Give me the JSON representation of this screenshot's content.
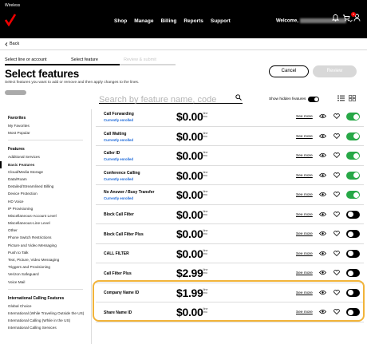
{
  "header": {
    "wireless_label": "Wireless",
    "nav": [
      "Shop",
      "Manage",
      "Billing",
      "Reports",
      "Support"
    ],
    "welcome": "Welcome,",
    "notification_count": "1"
  },
  "back_label": "Back",
  "steps": [
    "Select line or account",
    "Select feature",
    "Review & submit"
  ],
  "page": {
    "title": "Select features",
    "subtitle": "Select features you want to add or remove and then apply changes to the lines.",
    "cancel_label": "Cancel",
    "review_label": "Review"
  },
  "search": {
    "placeholder": "Search by feature name, code",
    "show_hidden_label": "Show hidden features"
  },
  "sidebar": {
    "groups": [
      {
        "title": "Favorites",
        "items": [
          "My Favorites",
          "Most Popular"
        ]
      },
      {
        "title": "Features",
        "items": [
          "Additional Services",
          "Basic Features",
          "Cloud/Media Storage",
          "Data/Roam",
          "Detailed/Streamlined Billing",
          "Device Protection",
          "HD Voice",
          "IP Provisioning",
          "Miscellaneous-Account Level",
          "Miscellaneous-Line Level",
          "Other",
          "Phone Switch Restrictions",
          "Picture and Video Messaging",
          "Push to Talk",
          "Text, Picture, Video Messaging",
          "Triggers and Provisioning",
          "Verizon Safeguard",
          "Voice Mail"
        ]
      },
      {
        "title": "International Calling Features",
        "items": [
          "Global Choice",
          "International (While Traveling Outside the US)",
          "International Calling (While in the US)",
          "International Calling Services"
        ]
      }
    ],
    "active_item": "Basic Features"
  },
  "features": [
    {
      "name": "Call Forwarding",
      "status": "Currently enrolled",
      "price": "$0.00",
      "per": [
        "/line",
        "/mo"
      ],
      "see_more": "See more",
      "enabled": true
    },
    {
      "name": "Call Waiting",
      "status": "Currently enrolled",
      "price": "$0.00",
      "per": [
        "/line",
        "/mo"
      ],
      "see_more": "See more",
      "enabled": true
    },
    {
      "name": "Caller ID",
      "status": "Currently enrolled",
      "price": "$0.00",
      "per": [
        "/line",
        "/mo"
      ],
      "see_more": "See more",
      "enabled": true
    },
    {
      "name": "Conference Calling",
      "status": "Currently enrolled",
      "price": "$0.00",
      "per": [
        "/line",
        "/mo"
      ],
      "see_more": "See more",
      "enabled": true
    },
    {
      "name": "No Answer / Busy Transfer",
      "status": "Currently enrolled",
      "price": "$0.00",
      "per": [
        "/line",
        "/mo"
      ],
      "see_more": "See more",
      "enabled": true
    },
    {
      "name": "Block Call Filter",
      "status": "",
      "price": "$0.00",
      "per": [
        "/line",
        "/mo"
      ],
      "see_more": "See more",
      "enabled": false
    },
    {
      "name": "Block Call Filter Plus",
      "status": "",
      "price": "$0.00",
      "per": [
        "/line",
        "/mo"
      ],
      "see_more": "See more",
      "enabled": false
    },
    {
      "name": "CALL FILTER",
      "status": "",
      "price": "$0.00",
      "per": [
        "/line",
        "/mo"
      ],
      "see_more": "See more",
      "enabled": false
    },
    {
      "name": "Call Filter Plus",
      "status": "",
      "price": "$2.99",
      "per": [
        "/line",
        "/mo"
      ],
      "see_more": "See more",
      "enabled": false
    },
    {
      "name": "Company Name ID",
      "status": "",
      "price": "$1.99",
      "per": [
        "/line",
        "/mo"
      ],
      "see_more": "See more",
      "enabled": false
    },
    {
      "name": "Share Name ID",
      "status": "",
      "price": "$0.00",
      "per": [
        "/line",
        "/mo"
      ],
      "see_more": "See more",
      "enabled": false
    }
  ],
  "colors": {
    "brand_red": "#ee0000",
    "toggle_on": "#26a846",
    "status_blue": "#1665d8",
    "highlight": "#f2b43a"
  }
}
